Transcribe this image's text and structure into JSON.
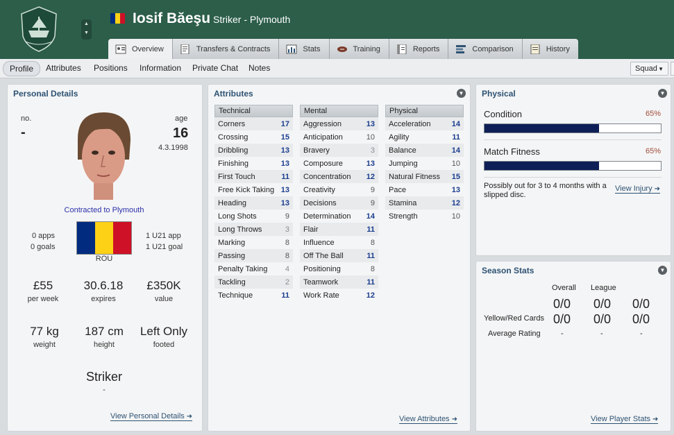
{
  "player": {
    "name": "Iosif Băeşu",
    "subtitle": "Striker - Plymouth",
    "flag_colors": [
      "#002b7f",
      "#fcd116",
      "#ce1126"
    ]
  },
  "header": {
    "bg": "#2c5e4a",
    "crest_icon": "club-crest-icon"
  },
  "tabs": [
    {
      "label": "Overview",
      "icon": "profile-card-icon",
      "active": true
    },
    {
      "label": "Transfers & Contracts",
      "icon": "contract-doc-icon"
    },
    {
      "label": "Stats",
      "icon": "stats-bar-icon"
    },
    {
      "label": "Training",
      "icon": "ball-icon"
    },
    {
      "label": "Reports",
      "icon": "report-book-icon"
    },
    {
      "label": "Comparison",
      "icon": "comparison-icon"
    },
    {
      "label": "History",
      "icon": "history-note-icon"
    }
  ],
  "subnav": {
    "items": [
      "Profile",
      "Attributes",
      "Positions",
      "Information",
      "Private Chat",
      "Notes"
    ],
    "squad_button": "Squad"
  },
  "personal": {
    "title": "Personal Details",
    "no_label": "no.",
    "no_value": "-",
    "age_label": "age",
    "age_value": "16",
    "dob": "4.3.1998",
    "contract": "Contracted to Plymouth",
    "apps": "0 apps",
    "goals": "0 goals",
    "u21_apps": "1 U21 app",
    "u21_goals": "1 U21 goal",
    "nation": "ROU",
    "wage": "£55",
    "wage_label": "per week",
    "expires": "30.6.18",
    "expires_label": "expires",
    "value": "£350K",
    "value_label": "value",
    "weight": "77 kg",
    "weight_label": "weight",
    "height": "187 cm",
    "height_label": "height",
    "foot": "Left Only",
    "foot_label": "footed",
    "position": "Striker",
    "position_sub": "-",
    "link": "View Personal Details"
  },
  "attributes": {
    "title": "Attributes",
    "link": "View Attributes",
    "technical": {
      "header": "Technical",
      "rows": [
        [
          "Corners",
          "17"
        ],
        [
          "Crossing",
          "15"
        ],
        [
          "Dribbling",
          "13"
        ],
        [
          "Finishing",
          "13"
        ],
        [
          "First Touch",
          "11"
        ],
        [
          "Free Kick Taking",
          "13"
        ],
        [
          "Heading",
          "13"
        ],
        [
          "Long Shots",
          "9"
        ],
        [
          "Long Throws",
          "3"
        ],
        [
          "Marking",
          "8"
        ],
        [
          "Passing",
          "8"
        ],
        [
          "Penalty Taking",
          "4"
        ],
        [
          "Tackling",
          "2"
        ],
        [
          "Technique",
          "11"
        ]
      ]
    },
    "mental": {
      "header": "Mental",
      "rows": [
        [
          "Aggression",
          "13"
        ],
        [
          "Anticipation",
          "10"
        ],
        [
          "Bravery",
          "3"
        ],
        [
          "Composure",
          "13"
        ],
        [
          "Concentration",
          "12"
        ],
        [
          "Creativity",
          "9"
        ],
        [
          "Decisions",
          "9"
        ],
        [
          "Determination",
          "14"
        ],
        [
          "Flair",
          "11"
        ],
        [
          "Influence",
          "8"
        ],
        [
          "Off The Ball",
          "11"
        ],
        [
          "Positioning",
          "8"
        ],
        [
          "Teamwork",
          "11"
        ],
        [
          "Work Rate",
          "12"
        ]
      ]
    },
    "physical": {
      "header": "Physical",
      "rows": [
        [
          "Acceleration",
          "14"
        ],
        [
          "Agility",
          "11"
        ],
        [
          "Balance",
          "14"
        ],
        [
          "Jumping",
          "10"
        ],
        [
          "Natural Fitness",
          "15"
        ],
        [
          "Pace",
          "13"
        ],
        [
          "Stamina",
          "12"
        ],
        [
          "Strength",
          "10"
        ]
      ]
    }
  },
  "physical_panel": {
    "title": "Physical",
    "condition_label": "Condition",
    "condition_value": "65%",
    "condition_fraction": 0.65,
    "fitness_label": "Match Fitness",
    "fitness_value": "65%",
    "fitness_fraction": 0.65,
    "injury_text": "Possibly out for 3 to 4 months with a slipped disc.",
    "injury_link": "View Injury"
  },
  "season": {
    "title": "Season Stats",
    "col_overall": "Overall",
    "col_league": "League",
    "cards_label": "Yellow/Red Cards",
    "rating_label": "Average Rating",
    "top_values": [
      "0/0",
      "0/0",
      "0/0"
    ],
    "card_values": [
      "0/0",
      "0/0",
      "0/0"
    ],
    "ratings": [
      "-",
      "-",
      "-"
    ],
    "link": "View Player Stats"
  }
}
